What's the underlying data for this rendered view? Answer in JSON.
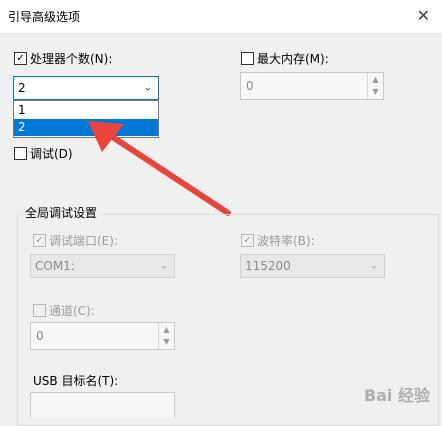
{
  "window": {
    "title": "引导高级选项",
    "close_glyph": "✕"
  },
  "processors": {
    "checked": true,
    "label": "处理器个数(N):",
    "value": "2",
    "options": [
      "1",
      "2"
    ],
    "selected_option": "2"
  },
  "max_memory": {
    "checked": false,
    "label": "最大内存(M):",
    "value": "0"
  },
  "debug": {
    "checked": false,
    "label": "调试(D)"
  },
  "global_debug": {
    "title": "全局调试设置",
    "debug_port": {
      "checked": true,
      "label": "调试端口(E):",
      "value": "COM1:"
    },
    "baud_rate": {
      "checked": true,
      "label": "波特率(B):",
      "value": "115200"
    },
    "channel": {
      "checked": false,
      "label": "通道(C):",
      "value": "0"
    },
    "usb_target": {
      "label": "USB 目标名(T):"
    }
  },
  "watermark": {
    "text": "Bai 经验"
  },
  "colors": {
    "accent": "#0078d7",
    "arrow": "#e8453c"
  }
}
